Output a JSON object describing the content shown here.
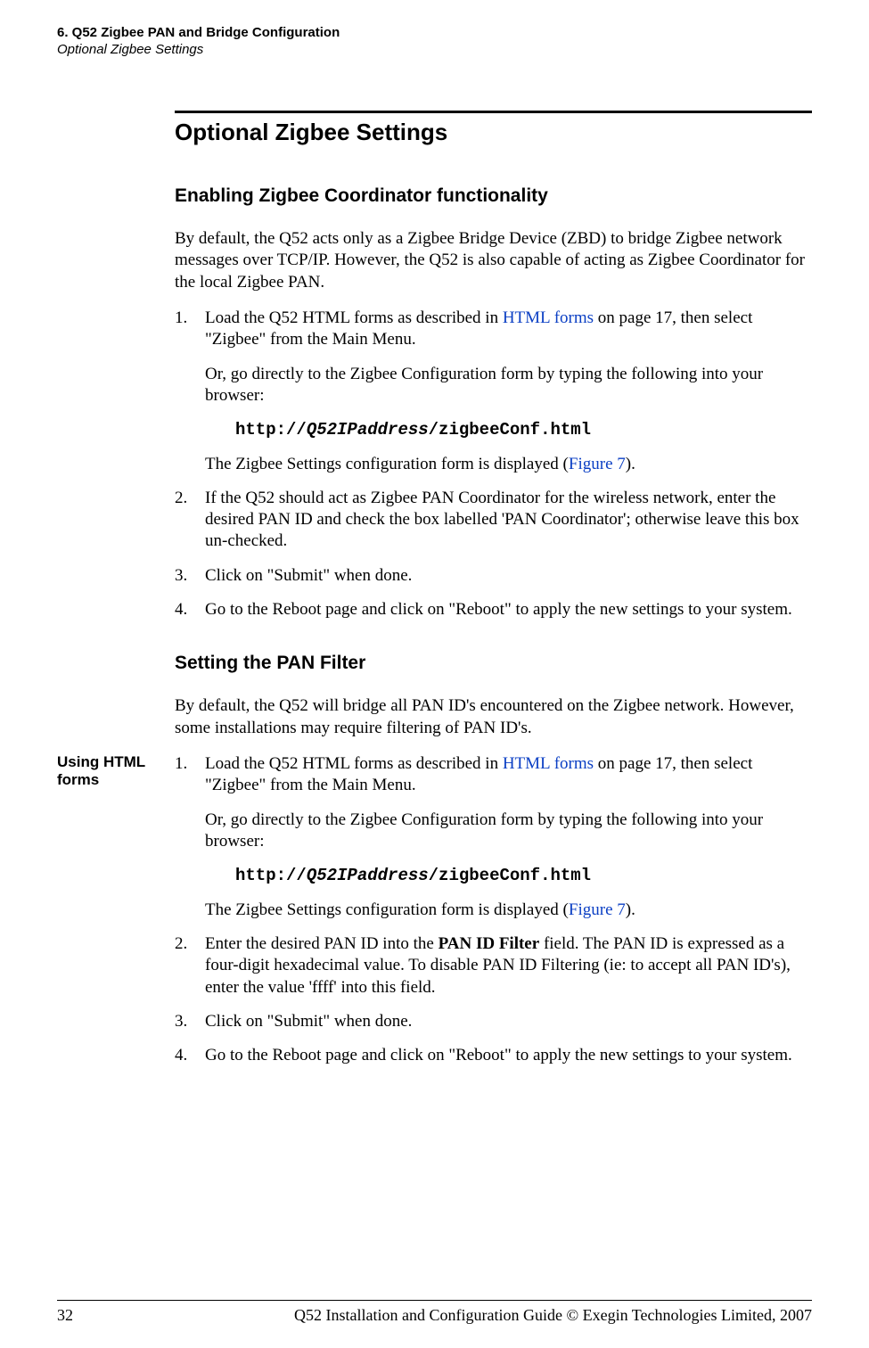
{
  "header": {
    "chapter": "6. Q52 Zigbee PAN and Bridge Configuration",
    "section": "Optional Zigbee Settings"
  },
  "section_title": "Optional Zigbee Settings",
  "subsec1": {
    "title": "Enabling Zigbee Coordinator functionality",
    "intro": "By default, the Q52 acts only as a Zigbee Bridge Device (ZBD) to bridge Zigbee network messages over TCP/IP. However, the Q52 is also capable of acting as Zigbee Coordinator for the local Zigbee PAN.",
    "steps": {
      "s1": {
        "pre": "Load the Q52 HTML forms as described in ",
        "link": "HTML forms",
        "post": " on page 17, then select \"Zigbee\" from the Main Menu.",
        "p2": "Or, go directly to the Zigbee Configuration form by typing the following into your browser:",
        "code_pre": "http://",
        "code_mid": "Q52IPaddress",
        "code_post": "/zigbeeConf.html",
        "p3_pre": "The Zigbee Settings configuration form is displayed (",
        "p3_link": "Figure 7",
        "p3_post": ")."
      },
      "s2": "If the Q52 should act as Zigbee PAN Coordinator for the wireless network, enter the desired PAN ID and check the box labelled 'PAN Coordinator'; otherwise leave this box un-checked.",
      "s3": "Click on \"Submit\" when done.",
      "s4": "Go to the Reboot page and click on \"Reboot\" to apply the new settings to your system."
    }
  },
  "subsec2": {
    "title": "Setting the PAN Filter",
    "intro": "By default, the Q52 will bridge all PAN ID's encountered on the Zigbee network. However, some installations may require filtering of PAN ID's.",
    "side_label": "Using HTML forms",
    "steps": {
      "s1": {
        "pre": "Load the Q52 HTML forms as described in ",
        "link": "HTML forms",
        "post": " on page 17, then select \"Zigbee\" from the Main Menu.",
        "p2": "Or, go directly to the Zigbee Configuration form by typing the following into your browser:",
        "code_pre": "http://",
        "code_mid": "Q52IPaddress",
        "code_post": "/zigbeeConf.html",
        "p3_pre": "The Zigbee Settings configuration form is displayed (",
        "p3_link": "Figure 7",
        "p3_post": ")."
      },
      "s2_pre": "Enter the desired PAN ID into the ",
      "s2_bold": "PAN ID Filter",
      "s2_post": " field. The PAN ID is expressed as a four-digit hexadecimal value. To disable PAN ID Filtering (ie: to accept all PAN ID's), enter the value 'ffff' into this field.",
      "s3": "Click on \"Submit\" when done.",
      "s4": "Go to the Reboot page and click on \"Reboot\" to apply the new settings to your system."
    }
  },
  "footer": {
    "page": "32",
    "text": "Q52 Installation and Configuration Guide  © Exegin Technologies Limited, 2007"
  }
}
